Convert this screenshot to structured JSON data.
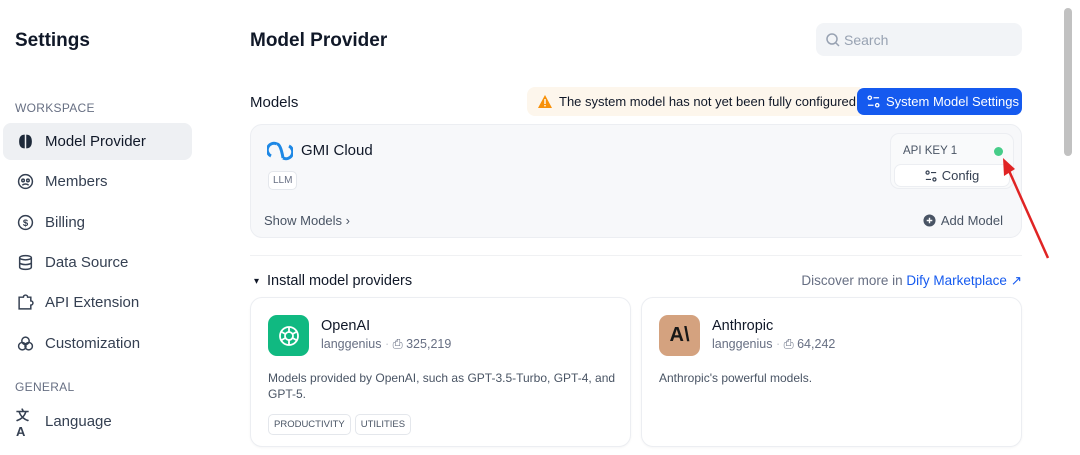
{
  "sidebar": {
    "title": "Settings",
    "sections": [
      {
        "label": "WORKSPACE"
      },
      {
        "label": "GENERAL"
      }
    ],
    "items": [
      {
        "label": "Model Provider",
        "icon": "brain-icon"
      },
      {
        "label": "Members",
        "icon": "members-icon"
      },
      {
        "label": "Billing",
        "icon": "dollar-icon"
      },
      {
        "label": "Data Source",
        "icon": "database-icon"
      },
      {
        "label": "API Extension",
        "icon": "puzzle-icon"
      },
      {
        "label": "Customization",
        "icon": "circles-icon"
      },
      {
        "label": "Language",
        "icon": "translate-icon"
      }
    ]
  },
  "header": {
    "title": "Model Provider",
    "search_placeholder": "Search"
  },
  "models": {
    "label": "Models",
    "warning": "The system model has not yet been fully configured",
    "system_button": "System Model Settings",
    "provider": {
      "name": "GMI Cloud",
      "tag": "LLM",
      "api_key": "API KEY 1",
      "status_color": "#47cd89",
      "config": "Config",
      "show_models": "Show Models",
      "add_model": "Add Model"
    }
  },
  "install": {
    "title": "Install model providers",
    "discover_prefix": "Discover more in",
    "discover_link": "Dify Marketplace",
    "cards": [
      {
        "name": "OpenAI",
        "author": "langgenius",
        "installs": "325,219",
        "description": "Models provided by OpenAI, such as GPT-3.5-Turbo, GPT-4, and GPT-5.",
        "tags": [
          "PRODUCTIVITY",
          "UTILITIES"
        ],
        "color": "#10b981"
      },
      {
        "name": "Anthropic",
        "author": "langgenius",
        "installs": "64,242",
        "description": "Anthropic's powerful models.",
        "tags": [],
        "color": "#d4a27f"
      }
    ]
  },
  "colors": {
    "accent": "#155aef",
    "warning": "#f79009"
  }
}
